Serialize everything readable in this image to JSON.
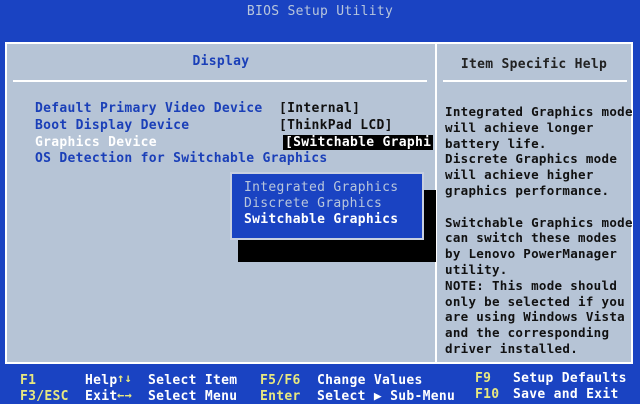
{
  "window": {
    "title": "BIOS Setup Utility"
  },
  "left_header": "Display",
  "right_header": "Item Specific Help",
  "options": [
    {
      "label": "Default Primary Video Device",
      "value": "[Internal]"
    },
    {
      "label": "Boot Display Device",
      "value": "[ThinkPad LCD]"
    },
    {
      "label": "Graphics Device",
      "value": "[Switchable Graphi"
    },
    {
      "label": "OS Detection for Switchable Graphics",
      "value": ""
    }
  ],
  "popup": {
    "items": [
      "Integrated Graphics",
      "Discrete Graphics",
      "Switchable Graphics"
    ]
  },
  "help": [
    "Integrated Graphics mode",
    "will achieve longer",
    "battery life.",
    "Discrete Graphics mode",
    "will achieve higher",
    "graphics performance.",
    "",
    "Switchable Graphics mode",
    "can switch these modes",
    "by Lenovo PowerManager",
    "utility.",
    "NOTE: This mode should",
    "only be selected if you",
    "are using Windows Vista",
    "and the corresponding",
    "driver installed."
  ],
  "footer": {
    "f1_key": "F1",
    "f1_desc": "Help",
    "arrows_key": "↑↓",
    "arrows_desc": "Select Item",
    "f5f6_key": "F5/F6",
    "f5f6_desc": "Change Values",
    "f9_key": "F9",
    "f9_desc": "Setup Defaults",
    "f3esc_key": "F3/ESC",
    "f3esc_desc": "Exit",
    "lr_key": "←→",
    "lr_desc": "Select Menu",
    "enter_key": "Enter",
    "enter_desc": "Select ▶ Sub-Menu",
    "f10_key": "F10",
    "f10_desc": "Save and Exit"
  }
}
